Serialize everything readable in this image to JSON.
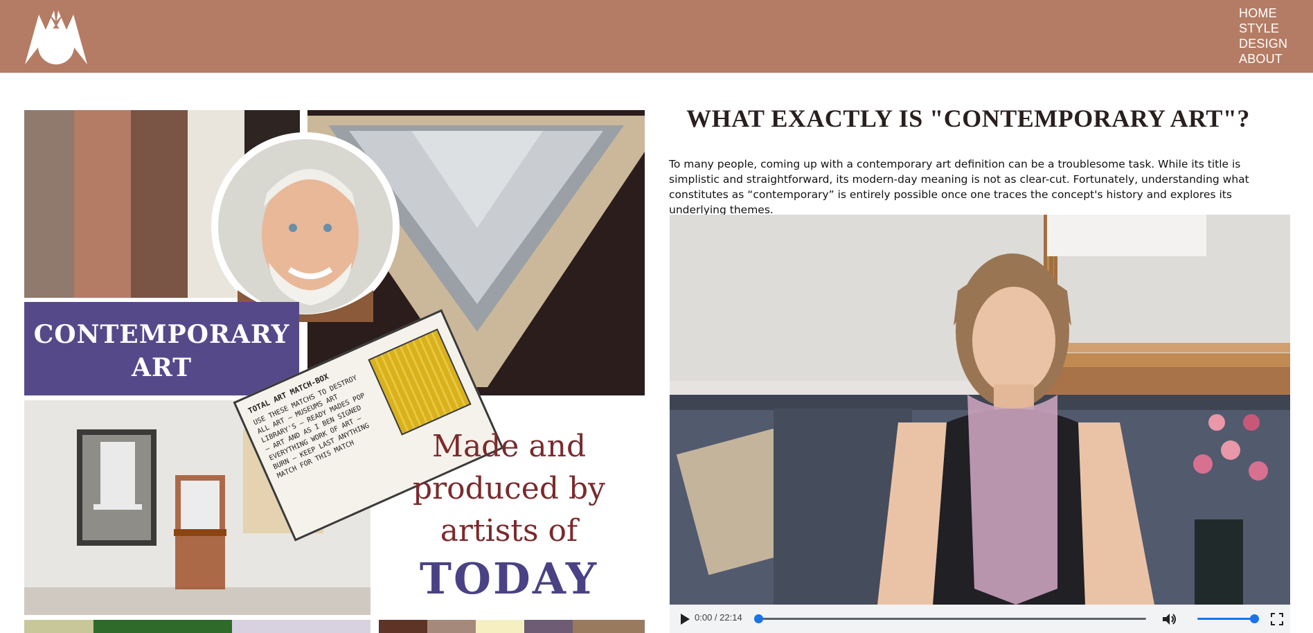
{
  "nav": {
    "items": [
      {
        "label": "HOME"
      },
      {
        "label": "STYLE"
      },
      {
        "label": "DESIGN"
      },
      {
        "label": "ABOUT"
      }
    ]
  },
  "collage": {
    "banner_line1": "CONTEMPORARY",
    "banner_line2": "ART",
    "made_line1": "Made and",
    "made_line2": "produced by",
    "made_line3": "artists of",
    "made_line4": "TODAY",
    "matchbox_title": "TOTAL ART MATCH-BOX",
    "matchbox_text": "USE THESE MATCHS TO DESTROY ALL ART — MUSEUMS ART LIBRARY'S — READY MADES POP — ART AND AS I BEN SIGNED EVERYTHING WORK OF ART — BURN — KEEP LAST ANYTHING MATCH FOR THIS MATCH",
    "palette_top": [
      "#8f7a6d",
      "#b47c64",
      "#7a5444",
      "#e9e5dc",
      "#2e2422"
    ],
    "palette_bottom": [
      "#5e3426",
      "#a58a7c",
      "#f5efc2",
      "#6d5c74",
      "#9a7a5e"
    ]
  },
  "article": {
    "title": "WHAT EXACTLY IS \"CONTEMPORARY ART\"?",
    "intro": "To many people, coming up with a contemporary art definition can be a troublesome task. While its title is simplistic and straightforward, its modern-day meaning is not as clear-cut. Fortunately, understanding what constitutes as “contemporary” is entirely possible once one traces the concept's history and explores its underlying themes."
  },
  "video": {
    "time": "0:00 / 22:14",
    "progress": 0,
    "volume": 1
  },
  "colors": {
    "header": "#b47c64",
    "accent": "#1a73e8",
    "banner_purple": "#56498a"
  }
}
